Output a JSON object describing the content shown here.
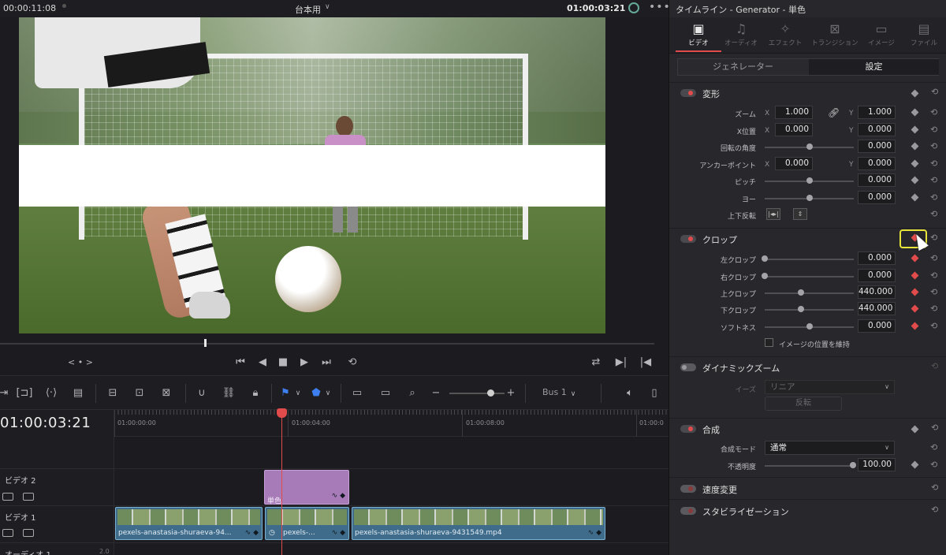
{
  "viewer": {
    "timecode_left": "00:00:11:08",
    "clip_name": "台本用",
    "timecode_right": "01:00:03:21",
    "nav_label": "< • >"
  },
  "timeline": {
    "timecode": "01:00:03:21",
    "ruler": [
      "01:00:00:00",
      "01:00:04:00",
      "01:00:08:00",
      "01:00:0"
    ],
    "tracks": [
      {
        "name": "ビデオ 2"
      },
      {
        "name": "ビデオ 1"
      },
      {
        "name": "オーディオ 1",
        "level": "2.0"
      }
    ],
    "bus": "Bus 1",
    "clips": {
      "generator": "単色",
      "video_a": "pexels-anastasia-shuraeva-94...",
      "video_b": "pexels-...",
      "video_c": "pexels-anastasia-shuraeva-9431549.mp4"
    }
  },
  "inspector": {
    "title": "タイムライン - Generator - 単色",
    "tabs": [
      {
        "label": "ビデオ",
        "icon": "video-icon",
        "active": true
      },
      {
        "label": "オーディオ",
        "icon": "audio-icon"
      },
      {
        "label": "エフェクト",
        "icon": "effects-icon"
      },
      {
        "label": "トランジション",
        "icon": "transition-icon"
      },
      {
        "label": "イメージ",
        "icon": "image-icon"
      },
      {
        "label": "ファイル",
        "icon": "file-icon"
      }
    ],
    "subtabs": [
      "ジェネレーター",
      "設定"
    ],
    "transform": {
      "title": "変形",
      "zoom_label": "ズーム",
      "zoom_x": "1.000",
      "zoom_y": "1.000",
      "position_label": "X位置",
      "position_x": "0.000",
      "position_y": "0.000",
      "rotation_label": "回転の角度",
      "rotation": "0.000",
      "anchor_label": "アンカーポイント",
      "anchor_x": "0.000",
      "anchor_y": "0.000",
      "pitch_label": "ピッチ",
      "pitch": "0.000",
      "yaw_label": "ヨー",
      "yaw": "0.000",
      "flip_label": "上下反転",
      "axis_x": "X",
      "axis_y": "Y"
    },
    "crop": {
      "title": "クロップ",
      "left_label": "左クロップ",
      "left": "0.000",
      "right_label": "右クロップ",
      "right": "0.000",
      "top_label": "上クロップ",
      "top": "440.000",
      "bottom_label": "下クロップ",
      "bottom": "440.000",
      "soft_label": "ソフトネス",
      "soft": "0.000",
      "retain_label": "イメージの位置を維持"
    },
    "dynamic_zoom": {
      "title": "ダイナミックズーム",
      "ease_label": "イーズ",
      "ease_value": "リニア",
      "swap_label": "反転"
    },
    "composite": {
      "title": "合成",
      "mode_label": "合成モード",
      "mode_value": "通常",
      "opacity_label": "不透明度",
      "opacity": "100.00"
    },
    "speed": {
      "title": "速度変更"
    },
    "stabilization": {
      "title": "スタビライゼーション"
    }
  },
  "colors": {
    "accent_red": "#e24b4b",
    "highlight_yellow": "#e8e43a",
    "clip_blue": "#3f6c8a",
    "clip_purple": "#a77bb8"
  }
}
